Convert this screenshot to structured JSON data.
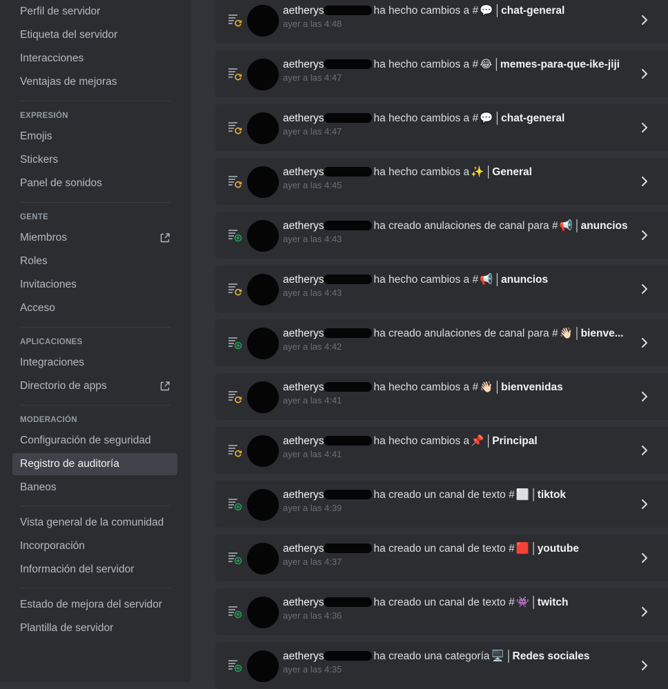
{
  "sidebar": {
    "items": [
      {
        "label": "Perfil de servidor"
      },
      {
        "label": "Etiqueta del servidor"
      },
      {
        "label": "Interacciones"
      },
      {
        "label": "Ventajas de mejoras"
      },
      {
        "label": "Emojis"
      },
      {
        "label": "Stickers"
      },
      {
        "label": "Panel de sonidos"
      },
      {
        "label": "Miembros"
      },
      {
        "label": "Roles"
      },
      {
        "label": "Invitaciones"
      },
      {
        "label": "Acceso"
      },
      {
        "label": "Integraciones"
      },
      {
        "label": "Directorio de apps"
      },
      {
        "label": "Configuración de seguridad"
      },
      {
        "label": "Registro de auditoría"
      },
      {
        "label": "Baneos"
      },
      {
        "label": "Vista general de la comunidad"
      },
      {
        "label": "Incorporación"
      },
      {
        "label": "Información del servidor"
      },
      {
        "label": "Estado de mejora del servidor"
      },
      {
        "label": "Plantilla de servidor"
      }
    ],
    "headers": {
      "expresion": "EXPRESIÓN",
      "gente": "GENTE",
      "aplicaciones": "APLICACIONES",
      "moderacion": "MODERACIÓN"
    }
  },
  "audit_log": {
    "entries": [
      {
        "user": "aetherys",
        "action": "ha hecho cambios a #",
        "emoji": "💬",
        "target": "chat-general",
        "time": "ayer a las 4:48",
        "kind": "update"
      },
      {
        "user": "aetherys",
        "action": "ha hecho cambios a #",
        "emoji": "😂",
        "target": "memes-para-que-ike-jiji",
        "time": "ayer a las 4:47",
        "kind": "update"
      },
      {
        "user": "aetherys",
        "action": "ha hecho cambios a #",
        "emoji": "💬",
        "target": "chat-general",
        "time": "ayer a las 4:47",
        "kind": "update"
      },
      {
        "user": "aetherys",
        "action": "ha hecho cambios a",
        "emoji": "✨",
        "target": "General",
        "time": "ayer a las 4:45",
        "kind": "update"
      },
      {
        "user": "aetherys",
        "action": "ha creado anulaciones de canal para #",
        "emoji": "📢",
        "target": "anuncios",
        "time": "ayer a las 4:43",
        "kind": "create"
      },
      {
        "user": "aetherys",
        "action": "ha hecho cambios a #",
        "emoji": "📢",
        "target": "anuncios",
        "time": "ayer a las 4:43",
        "kind": "update"
      },
      {
        "user": "aetherys",
        "action": "ha creado anulaciones de canal para #",
        "emoji": "👋🏻",
        "target": "bienve...",
        "time": "ayer a las 4:42",
        "kind": "create"
      },
      {
        "user": "aetherys",
        "action": "ha hecho cambios a #",
        "emoji": "👋🏻",
        "target": "bienvenidas",
        "time": "ayer a las 4:41",
        "kind": "update"
      },
      {
        "user": "aetherys",
        "action": "ha hecho cambios a",
        "emoji": "📌",
        "target": "Principal",
        "time": "ayer a las 4:41",
        "kind": "update"
      },
      {
        "user": "aetherys",
        "action": "ha creado un canal de texto #",
        "emoji": "⬜",
        "target": "tiktok",
        "time": "ayer a las 4:39",
        "kind": "create"
      },
      {
        "user": "aetherys",
        "action": "ha creado un canal de texto #",
        "emoji": "🟥",
        "target": "youtube",
        "time": "ayer a las 4:37",
        "kind": "create"
      },
      {
        "user": "aetherys",
        "action": "ha creado un canal de texto #",
        "emoji": "👾",
        "target": "twitch",
        "time": "ayer a las 4:36",
        "kind": "create"
      },
      {
        "user": "aetherys",
        "action": "ha creado una categoría",
        "emoji": "🖥️",
        "target": "Redes sociales",
        "time": "ayer a las 4:35",
        "kind": "create"
      }
    ]
  },
  "colors": {
    "update": "#f0b232",
    "create": "#23a55a",
    "active_nav": "#404249"
  },
  "icons": {
    "external": "external-link-icon",
    "update": "audit-update-icon",
    "create": "audit-create-icon",
    "chevron": "chevron-right-icon"
  }
}
